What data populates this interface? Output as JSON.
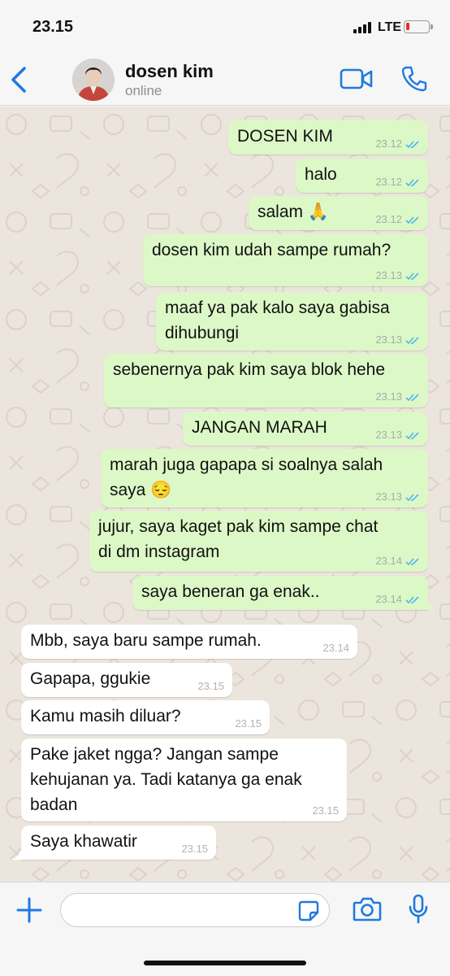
{
  "status_bar": {
    "time": "23.15",
    "network": "LTE"
  },
  "header": {
    "contact_name": "dosen kim",
    "contact_status": "online"
  },
  "messages": [
    {
      "direction": "out",
      "text": "DOSEN KIM",
      "time": "23.12",
      "read": true
    },
    {
      "direction": "out",
      "text": "halo",
      "time": "23.12",
      "read": true
    },
    {
      "direction": "out",
      "text": "salam 🙏",
      "time": "23.12",
      "read": true
    },
    {
      "direction": "out",
      "text": "dosen kim udah sampe rumah?",
      "time": "23.13",
      "read": true
    },
    {
      "direction": "out",
      "text": "maaf ya pak kalo saya gabisa\ndihubungi",
      "time": "23.13",
      "read": true
    },
    {
      "direction": "out",
      "text": "sebenernya pak kim saya blok hehe",
      "time": "23.13",
      "read": true
    },
    {
      "direction": "out",
      "text": "JANGAN MARAH",
      "time": "23.13",
      "read": true
    },
    {
      "direction": "out",
      "text": "marah juga gapapa si soalnya salah\nsaya 😔",
      "time": "23.13",
      "read": true
    },
    {
      "direction": "out",
      "text": "jujur, saya kaget pak kim sampe chat\ndi dm instagram",
      "time": "23.14",
      "read": true
    },
    {
      "direction": "out",
      "text": "saya beneran ga enak..",
      "time": "23.14",
      "read": true
    },
    {
      "direction": "in",
      "text": "Mbb, saya baru sampe rumah.",
      "time": "23.14"
    },
    {
      "direction": "in",
      "text": "Gapapa, ggukie",
      "time": "23.15"
    },
    {
      "direction": "in",
      "text": "Kamu masih diluar?",
      "time": "23.15"
    },
    {
      "direction": "in",
      "text": "Pake jaket ngga? Jangan sampe\nkehujanan ya. Tadi katanya ga enak\nbadan",
      "time": "23.15"
    },
    {
      "direction": "in",
      "text": "Saya khawatir",
      "time": "23.15"
    }
  ],
  "input": {
    "value": "",
    "placeholder": ""
  },
  "icons": {
    "back": "chevron-left-icon",
    "video": "video-camera-icon",
    "call": "phone-icon",
    "plus": "plus-icon",
    "sticker": "sticker-icon",
    "camera": "camera-icon",
    "mic": "microphone-icon"
  },
  "colors": {
    "accent": "#1f7ae0",
    "outgoing_bubble": "#dcf8c6",
    "incoming_bubble": "#ffffff",
    "chat_background": "#ece5dd",
    "read_ticks": "#4fb6ec",
    "battery_low": "#e5322e"
  }
}
